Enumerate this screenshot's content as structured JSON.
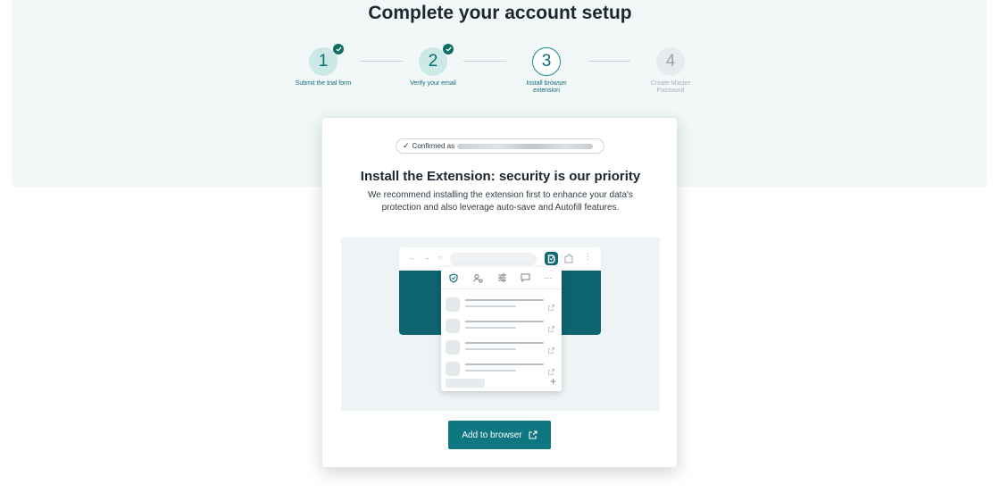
{
  "page": {
    "title": "Complete your account setup"
  },
  "stepper": {
    "steps": [
      {
        "number": "1",
        "label": "Submit the trial form",
        "status": "done"
      },
      {
        "number": "2",
        "label": "Verify your email",
        "status": "done"
      },
      {
        "number": "3",
        "label": "Install browser extension",
        "status": "current"
      },
      {
        "number": "4",
        "label": "Create Master Password",
        "status": "todo"
      }
    ]
  },
  "card": {
    "confirmed_label": "Confirmed as",
    "title": "Install the Extension: security is our priority",
    "description": "We recommend installing the extension first to enhance your data's protection and also leverage auto-save and Autofill features.",
    "add_button_label": "Add to browser"
  },
  "illustration": {
    "nav_glyphs": "← → ○",
    "kebab": "⋮",
    "more_tab": "···",
    "plus": "+"
  },
  "colors": {
    "accent": "#0e7782",
    "hero_background": "#f2f8f8",
    "step_done": "#cde9e5",
    "check_badge": "#0d6e62"
  }
}
